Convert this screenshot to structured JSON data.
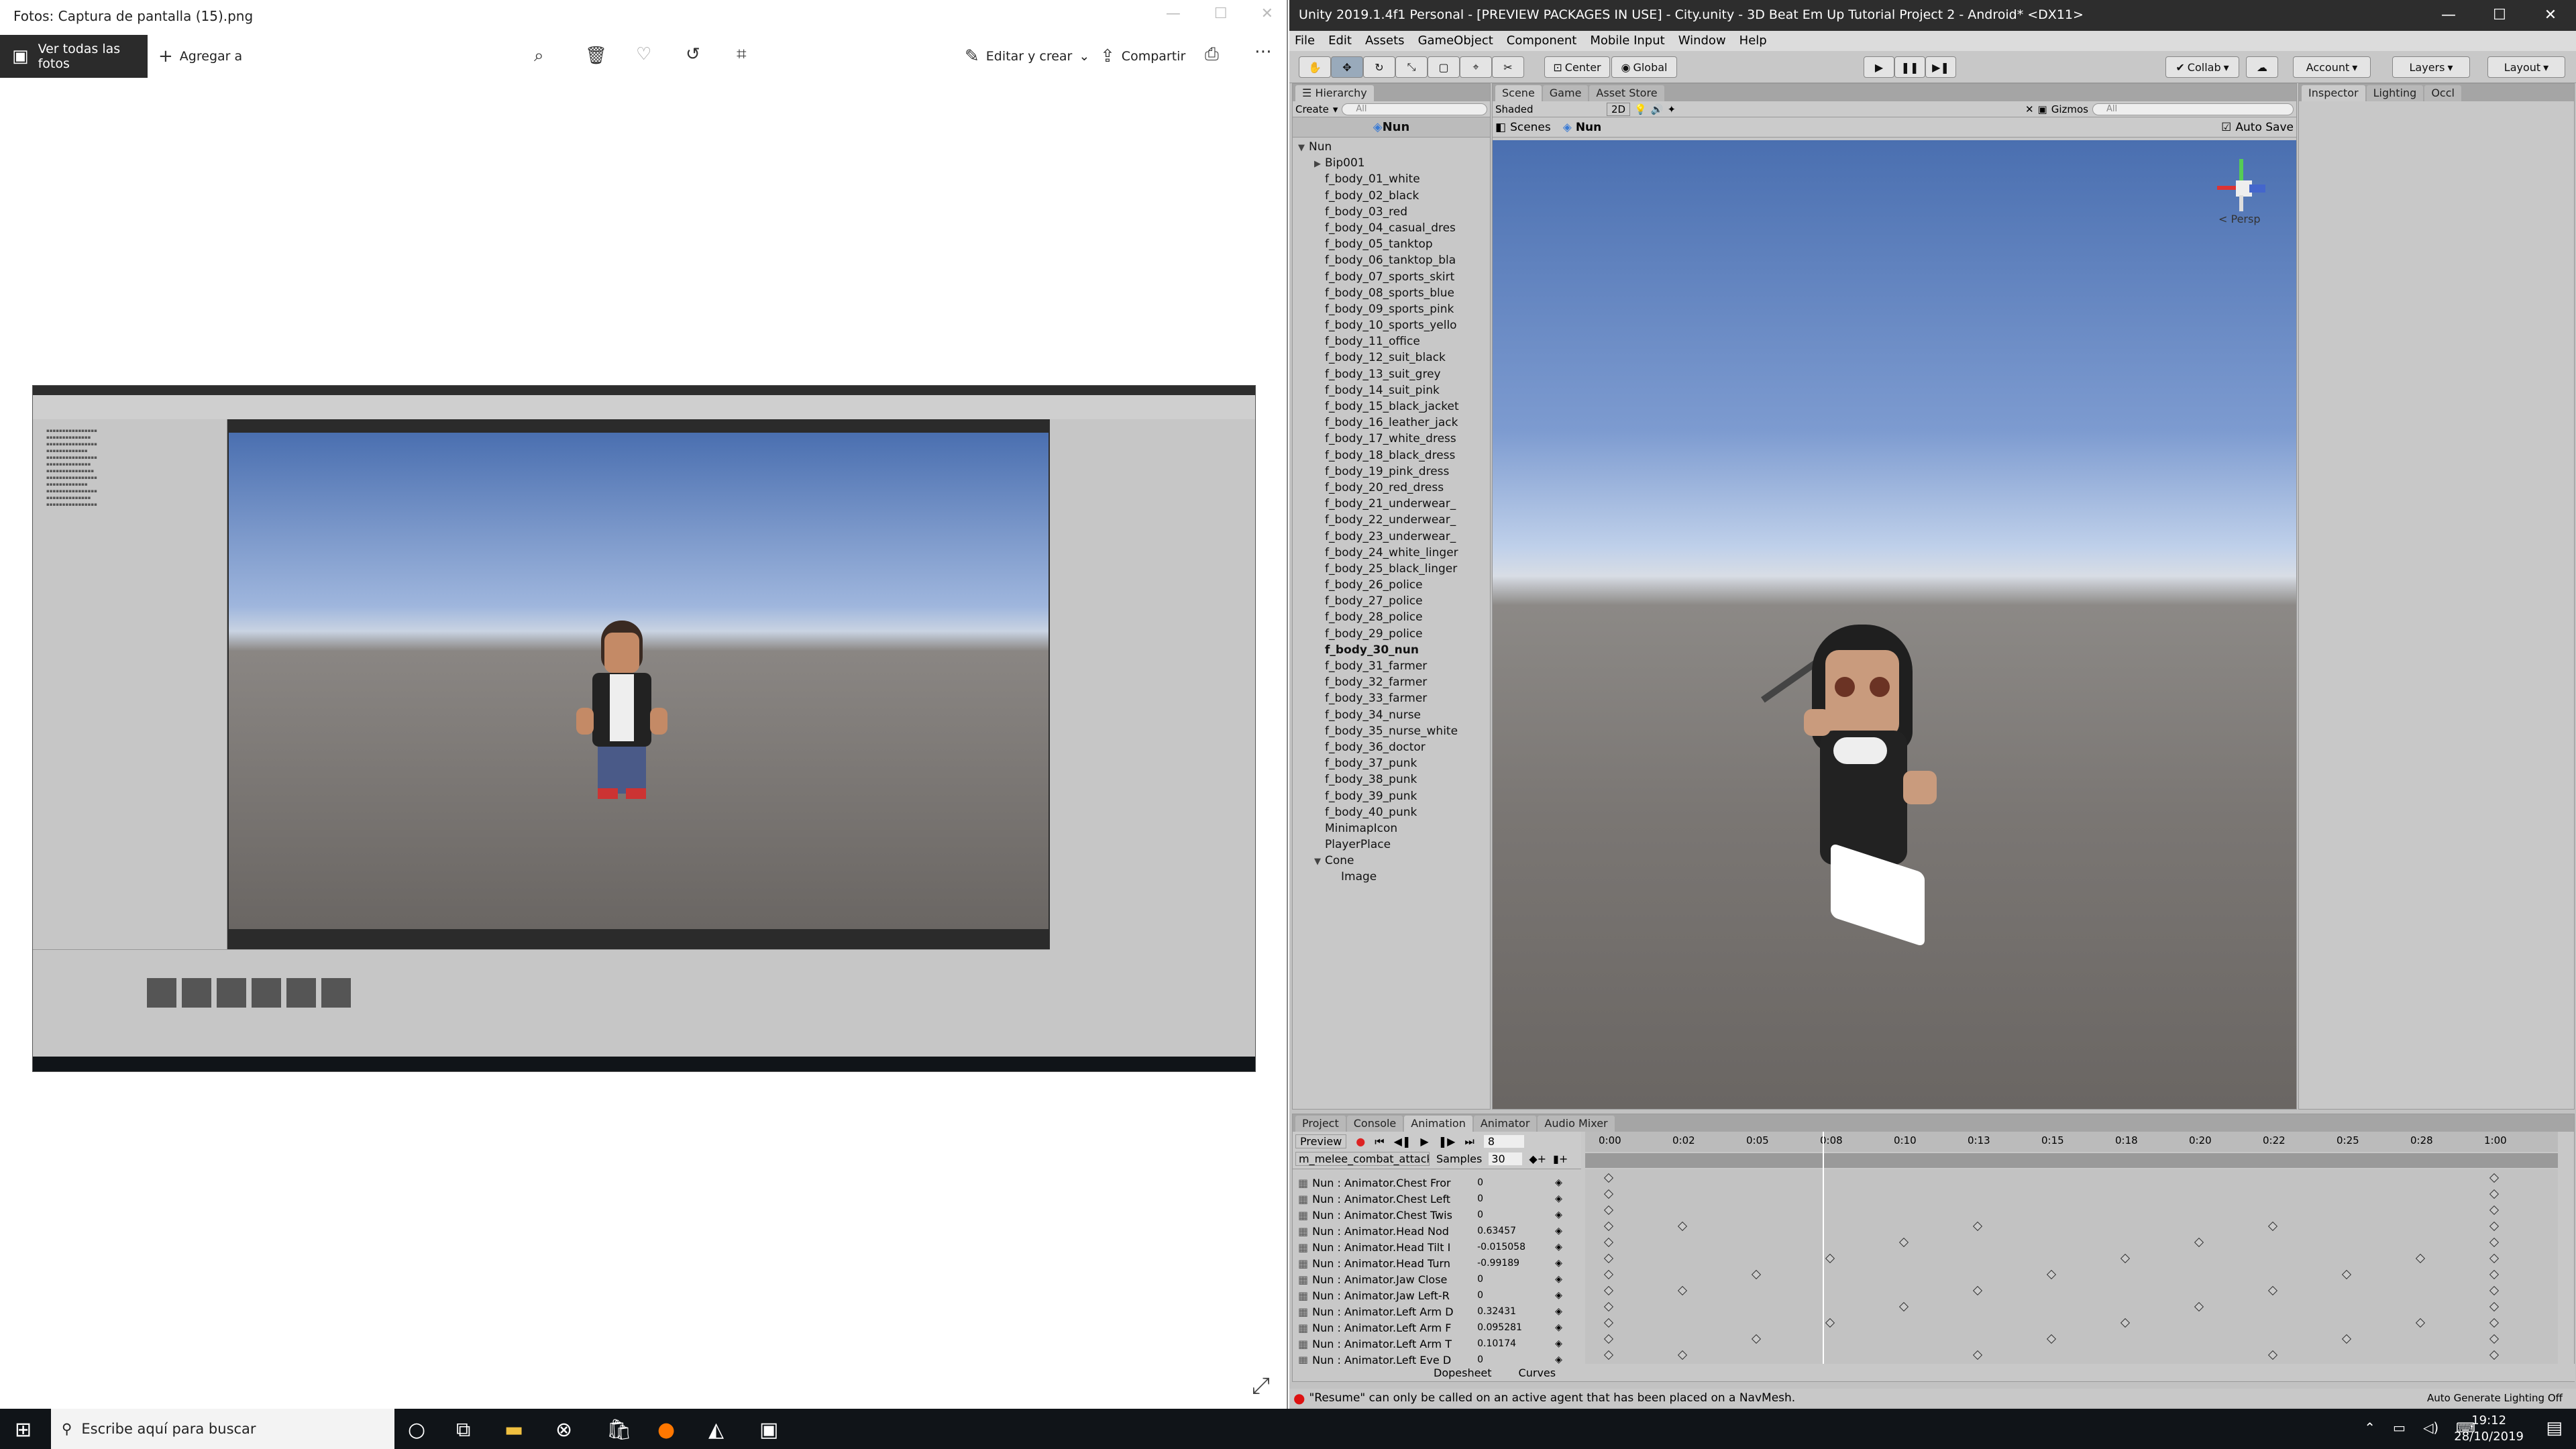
{
  "photos": {
    "title": "Fotos: Captura de pantalla (15).png",
    "view_all": "Ver todas las fotos",
    "add": "Agregar a",
    "edit_create": "Editar y crear",
    "share": "Compartir"
  },
  "unity": {
    "title": "Unity 2019.1.4f1 Personal - [PREVIEW PACKAGES IN USE] - City.unity - 3D Beat Em Up Tutorial Project 2 - Android* <DX11>",
    "menu": [
      "File",
      "Edit",
      "Assets",
      "GameObject",
      "Component",
      "Mobile Input",
      "Window",
      "Help"
    ],
    "toolbar": {
      "center": "Center",
      "global": "Global",
      "collab": "Collab",
      "account": "Account",
      "layers": "Layers",
      "layout": "Layout"
    },
    "hierarchy": {
      "tab": "Hierarchy",
      "create": "Create",
      "search": "All",
      "header": "Nun",
      "items": [
        {
          "label": "Nun",
          "indent": 0,
          "expanded": true
        },
        {
          "label": "Bip001",
          "indent": 1,
          "collapsed": true
        },
        {
          "label": "f_body_01_white",
          "indent": 1
        },
        {
          "label": "f_body_02_black",
          "indent": 1
        },
        {
          "label": "f_body_03_red",
          "indent": 1
        },
        {
          "label": "f_body_04_casual_dres",
          "indent": 1
        },
        {
          "label": "f_body_05_tanktop",
          "indent": 1
        },
        {
          "label": "f_body_06_tanktop_bla",
          "indent": 1
        },
        {
          "label": "f_body_07_sports_skirt",
          "indent": 1
        },
        {
          "label": "f_body_08_sports_blue",
          "indent": 1
        },
        {
          "label": "f_body_09_sports_pink",
          "indent": 1
        },
        {
          "label": "f_body_10_sports_yello",
          "indent": 1
        },
        {
          "label": "f_body_11_office",
          "indent": 1
        },
        {
          "label": "f_body_12_suit_black",
          "indent": 1
        },
        {
          "label": "f_body_13_suit_grey",
          "indent": 1
        },
        {
          "label": "f_body_14_suit_pink",
          "indent": 1
        },
        {
          "label": "f_body_15_black_jacket",
          "indent": 1
        },
        {
          "label": "f_body_16_leather_jack",
          "indent": 1
        },
        {
          "label": "f_body_17_white_dress",
          "indent": 1
        },
        {
          "label": "f_body_18_black_dress",
          "indent": 1
        },
        {
          "label": "f_body_19_pink_dress",
          "indent": 1
        },
        {
          "label": "f_body_20_red_dress",
          "indent": 1
        },
        {
          "label": "f_body_21_underwear_",
          "indent": 1
        },
        {
          "label": "f_body_22_underwear_",
          "indent": 1
        },
        {
          "label": "f_body_23_underwear_",
          "indent": 1
        },
        {
          "label": "f_body_24_white_linger",
          "indent": 1
        },
        {
          "label": "f_body_25_black_linger",
          "indent": 1
        },
        {
          "label": "f_body_26_police",
          "indent": 1
        },
        {
          "label": "f_body_27_police",
          "indent": 1
        },
        {
          "label": "f_body_28_police",
          "indent": 1
        },
        {
          "label": "f_body_29_police",
          "indent": 1
        },
        {
          "label": "f_body_30_nun",
          "indent": 1,
          "bold": true
        },
        {
          "label": "f_body_31_farmer",
          "indent": 1
        },
        {
          "label": "f_body_32_farmer",
          "indent": 1
        },
        {
          "label": "f_body_33_farmer",
          "indent": 1
        },
        {
          "label": "f_body_34_nurse",
          "indent": 1
        },
        {
          "label": "f_body_35_nurse_white",
          "indent": 1
        },
        {
          "label": "f_body_36_doctor",
          "indent": 1
        },
        {
          "label": "f_body_37_punk",
          "indent": 1
        },
        {
          "label": "f_body_38_punk",
          "indent": 1
        },
        {
          "label": "f_body_39_punk",
          "indent": 1
        },
        {
          "label": "f_body_40_punk",
          "indent": 1
        },
        {
          "label": "MinimapIcon",
          "indent": 1
        },
        {
          "label": "PlayerPlace",
          "indent": 1
        },
        {
          "label": "Cone",
          "indent": 1,
          "expanded": true
        },
        {
          "label": "Image",
          "indent": 2
        }
      ]
    },
    "scene": {
      "tabs": [
        "Scene",
        "Game",
        "Asset Store"
      ],
      "shaded": "Shaded",
      "mode2d": "2D",
      "gizmos": "Gizmos",
      "search": "All",
      "breadcrumb_root": "Scenes",
      "breadcrumb_obj": "Nun",
      "autosave": "Auto Save",
      "persp": "< Persp"
    },
    "inspector_tabs": [
      "Inspector",
      "Lighting",
      "Occl"
    ],
    "anim": {
      "tabs": [
        "Project",
        "Console",
        "Animation",
        "Animator",
        "Audio Mixer"
      ],
      "preview": "Preview",
      "frame": "8",
      "clip": "m_melee_combat_attack",
      "samples_label": "Samples",
      "samples": "30",
      "timeline": [
        "0:00",
        "0:02",
        "0:05",
        "0:08",
        "0:10",
        "0:13",
        "0:15",
        "0:18",
        "0:20",
        "0:22",
        "0:25",
        "0:28",
        "1:00"
      ],
      "props": [
        {
          "name": "Nun : Animator.Chest Fror",
          "value": "0"
        },
        {
          "name": "Nun : Animator.Chest Left",
          "value": "0"
        },
        {
          "name": "Nun : Animator.Chest Twis",
          "value": "0"
        },
        {
          "name": "Nun : Animator.Head Nod",
          "value": "0.63457"
        },
        {
          "name": "Nun : Animator.Head Tilt I",
          "value": "-0.015058"
        },
        {
          "name": "Nun : Animator.Head Turn",
          "value": "-0.99189"
        },
        {
          "name": "Nun : Animator.Jaw Close",
          "value": "0"
        },
        {
          "name": "Nun : Animator.Jaw Left-R",
          "value": "0"
        },
        {
          "name": "Nun : Animator.Left Arm D",
          "value": "0.32431"
        },
        {
          "name": "Nun : Animator.Left Arm F",
          "value": "0.095281"
        },
        {
          "name": "Nun : Animator.Left Arm T",
          "value": "0.10174"
        },
        {
          "name": "Nun : Animator.Left Eye D",
          "value": "0"
        }
      ],
      "bottom_tabs": [
        "Dopesheet",
        "Curves"
      ]
    },
    "status": "\"Resume\" can only be called on an active agent that has been placed on a NavMesh.",
    "lighting_note": "Auto Generate Lighting Off"
  },
  "taskbar": {
    "search": "Escribe aquí para buscar",
    "time": "19:12",
    "date": "28/10/2019"
  }
}
